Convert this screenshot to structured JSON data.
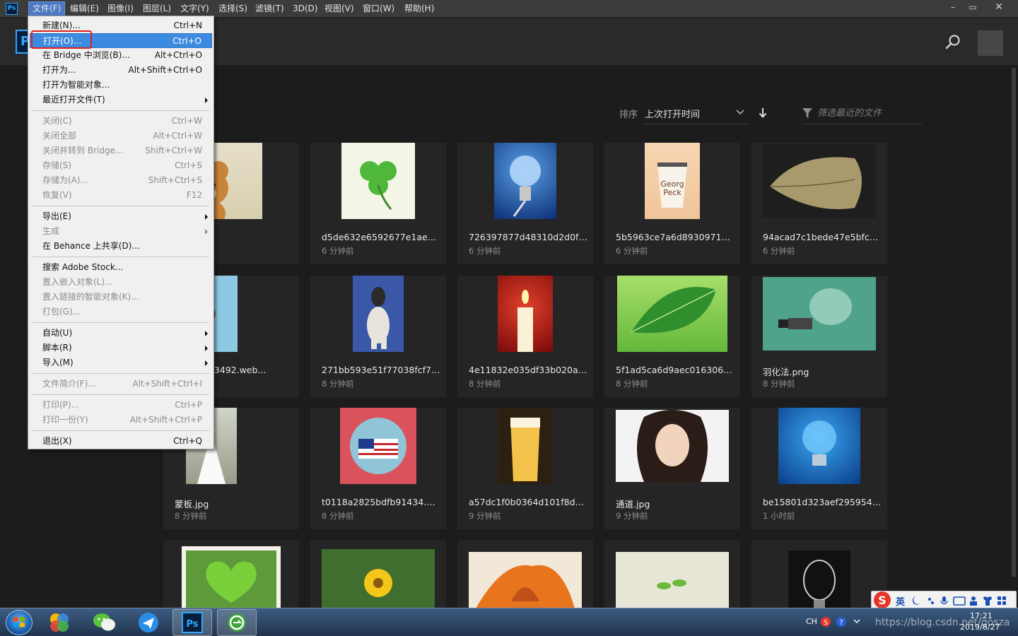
{
  "menubar": {
    "items": [
      "文件(F)",
      "编辑(E)",
      "图像(I)",
      "图层(L)",
      "文字(Y)",
      "选择(S)",
      "滤镜(T)",
      "3D(D)",
      "视图(V)",
      "窗口(W)",
      "帮助(H)"
    ],
    "window_buttons": [
      "–",
      "▭",
      "✕"
    ]
  },
  "app": {
    "logo_small": "Ps",
    "logo_big": "P"
  },
  "toolbar": {
    "sort_label": "排序",
    "sort_value": "上次打开时间",
    "filter_placeholder": "筛选最近的文件"
  },
  "file_menu": {
    "groups": [
      [
        {
          "label": "新建(N)...",
          "shortcut": "Ctrl+N",
          "enabled": true
        },
        {
          "label": "打开(O)...",
          "shortcut": "Ctrl+O",
          "enabled": true,
          "highlighted": true
        },
        {
          "label": "在 Bridge 中浏览(B)...",
          "shortcut": "Alt+Ctrl+O",
          "enabled": true
        },
        {
          "label": "打开为...",
          "shortcut": "Alt+Shift+Ctrl+O",
          "enabled": true
        },
        {
          "label": "打开为智能对象...",
          "shortcut": "",
          "enabled": true
        },
        {
          "label": "最近打开文件(T)",
          "shortcut": "",
          "enabled": true,
          "submenu": true
        }
      ],
      [
        {
          "label": "关闭(C)",
          "shortcut": "Ctrl+W",
          "enabled": false
        },
        {
          "label": "关闭全部",
          "shortcut": "Alt+Ctrl+W",
          "enabled": false
        },
        {
          "label": "关闭并转到 Bridge...",
          "shortcut": "Shift+Ctrl+W",
          "enabled": false
        },
        {
          "label": "存储(S)",
          "shortcut": "Ctrl+S",
          "enabled": false
        },
        {
          "label": "存储为(A)...",
          "shortcut": "Shift+Ctrl+S",
          "enabled": false
        },
        {
          "label": "恢复(V)",
          "shortcut": "F12",
          "enabled": false
        }
      ],
      [
        {
          "label": "导出(E)",
          "shortcut": "",
          "enabled": true,
          "submenu": true
        },
        {
          "label": "生成",
          "shortcut": "",
          "enabled": false,
          "submenu": true
        },
        {
          "label": "在 Behance 上共享(D)...",
          "shortcut": "",
          "enabled": true
        }
      ],
      [
        {
          "label": "搜索 Adobe Stock...",
          "shortcut": "",
          "enabled": true
        },
        {
          "label": "置入嵌入对象(L)...",
          "shortcut": "",
          "enabled": false
        },
        {
          "label": "置入链接的智能对象(K)...",
          "shortcut": "",
          "enabled": false
        },
        {
          "label": "打包(G)...",
          "shortcut": "",
          "enabled": false
        }
      ],
      [
        {
          "label": "自动(U)",
          "shortcut": "",
          "enabled": true,
          "submenu": true
        },
        {
          "label": "脚本(R)",
          "shortcut": "",
          "enabled": true,
          "submenu": true
        },
        {
          "label": "导入(M)",
          "shortcut": "",
          "enabled": true,
          "submenu": true
        }
      ],
      [
        {
          "label": "文件简介(F)...",
          "shortcut": "Alt+Shift+Ctrl+I",
          "enabled": false
        }
      ],
      [
        {
          "label": "打印(P)...",
          "shortcut": "Ctrl+P",
          "enabled": false
        },
        {
          "label": "打印一份(Y)",
          "shortcut": "Alt+Shift+Ctrl+P",
          "enabled": false
        }
      ],
      [
        {
          "label": "退出(X)",
          "shortcut": "Ctrl+Q",
          "enabled": true
        }
      ]
    ]
  },
  "recent_files": [
    {
      "name": "",
      "time": "",
      "art": "bear"
    },
    {
      "name": "d5de632e6592677e1aeabf...",
      "time": "6 分钟前",
      "art": "clover"
    },
    {
      "name": "726397877d48310d2d0fe1b...",
      "time": "6 分钟前",
      "art": "bulb-blue"
    },
    {
      "name": "5b5963ce7a6d8930971257...",
      "time": "6 分钟前",
      "art": "cup"
    },
    {
      "name": "94acad7c1bede47e5bfccc0...",
      "time": "6 分钟前",
      "art": "leaf-dry"
    },
    {
      "name": "...429fa93492.web...",
      "time": "",
      "art": "watch"
    },
    {
      "name": "271bb593e51f77038fcf7019...",
      "time": "8 分钟前",
      "art": "dog"
    },
    {
      "name": "4e11832e035df33b020ad0...",
      "time": "8 分钟前",
      "art": "candle"
    },
    {
      "name": "5f1ad5ca6d9aec01630656b...",
      "time": "8 分钟前",
      "art": "leaf-green"
    },
    {
      "name": "羽化法.png",
      "time": "8 分钟前",
      "art": "bulb-green"
    },
    {
      "name": "蒙板.jpg",
      "time": "8 分钟前",
      "art": "bride"
    },
    {
      "name": "t0118a2825bdfb91434.web...",
      "time": "8 分钟前",
      "art": "usa"
    },
    {
      "name": "a57dc1f0b0364d101f8d9d6...",
      "time": "9 分钟前",
      "art": "beer"
    },
    {
      "name": "通道.jpg",
      "time": "9 分钟前",
      "art": "woman"
    },
    {
      "name": "be15801d323aef295954459...",
      "time": "1 小时前",
      "art": "bulb-cyan"
    },
    {
      "name": "",
      "time": "",
      "art": "heart-leaf"
    },
    {
      "name": "",
      "time": "",
      "art": "flower"
    },
    {
      "name": "",
      "time": "",
      "art": "autumn"
    },
    {
      "name": "",
      "time": "",
      "art": "sprout"
    },
    {
      "name": "",
      "time": "",
      "art": "bulb-dark"
    }
  ],
  "taskbar": {
    "apps": [
      "start-orb",
      "photo-app-icon",
      "wechat-icon",
      "messenger-icon",
      "photoshop-icon",
      "browser-icon"
    ],
    "lang": "CH",
    "time": "17:21",
    "date": "2019/8/27",
    "ime_label": "英",
    "watermark": "https://blog.csdn.net/gosza"
  },
  "colors": {
    "accent": "#31a8ff",
    "menu_highlight": "#3d8be0",
    "annotation_red": "#e0201e"
  }
}
